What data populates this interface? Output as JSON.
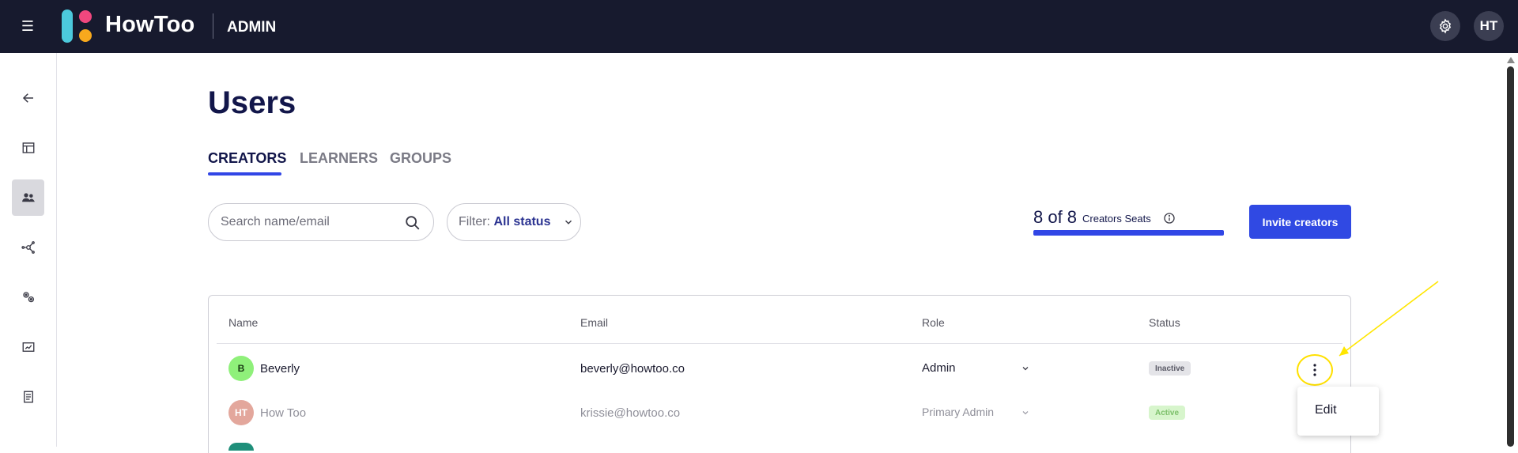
{
  "header": {
    "brand": "HowToo",
    "section": "ADMIN",
    "user_initials": "HT"
  },
  "page": {
    "title": "Users"
  },
  "tabs": [
    {
      "label": "CREATORS",
      "active": true
    },
    {
      "label": "LEARNERS",
      "active": false
    },
    {
      "label": "GROUPS",
      "active": false
    }
  ],
  "search": {
    "placeholder": "Search name/email"
  },
  "filter": {
    "label": "Filter:",
    "value": "All status"
  },
  "seats": {
    "count": "8 of 8",
    "label": "Creators Seats",
    "used_fraction": 1.0
  },
  "invite": {
    "label": "Invite creators"
  },
  "table": {
    "columns": [
      "Name",
      "Email",
      "Role",
      "Status"
    ],
    "rows": [
      {
        "initials": "B",
        "name": "Beverly",
        "email": "beverly@howtoo.co",
        "role": "Admin",
        "status": "Inactive"
      },
      {
        "initials": "HT",
        "name": "How Too",
        "email": "krissie@howtoo.co",
        "role": "Primary Admin",
        "status": "Active"
      }
    ]
  },
  "row_menu": {
    "items": [
      "Edit"
    ]
  },
  "colors": {
    "topbar": "#171a2e",
    "accent": "#3049e3",
    "title": "#12164a",
    "highlight": "#ffe000"
  },
  "icons": {
    "sidebar": [
      "back-arrow-icon",
      "layout-icon",
      "users-icon",
      "network-icon",
      "settings-icon",
      "analytics-icon",
      "document-icon"
    ]
  }
}
